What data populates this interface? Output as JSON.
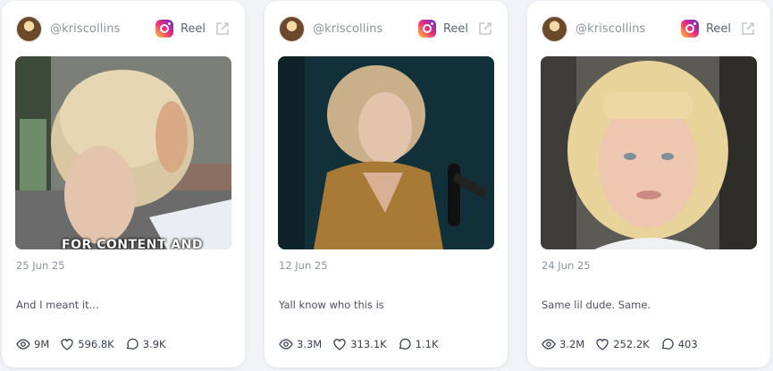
{
  "cards": [
    {
      "handle": "@kriscollins",
      "platform_icon": "instagram-icon",
      "type": "Reel",
      "thumb_overlay": "FOR CONTENT AND",
      "date": "25 Jun 25",
      "text": "And I meant it...",
      "views": "9M",
      "likes": "596.8K",
      "comments": "3.9K"
    },
    {
      "handle": "@kriscollins",
      "platform_icon": "instagram-icon",
      "type": "Reel",
      "date": "12 Jun 25",
      "text": "Yall know who this is",
      "views": "3.3M",
      "likes": "313.1K",
      "comments": "1.1K"
    },
    {
      "handle": "@kriscollins",
      "platform_icon": "instagram-icon",
      "type": "Reel",
      "date": "24 Jun 25",
      "text": "Same lil dude. Same.",
      "views": "3.2M",
      "likes": "252.2K",
      "comments": "403"
    }
  ]
}
